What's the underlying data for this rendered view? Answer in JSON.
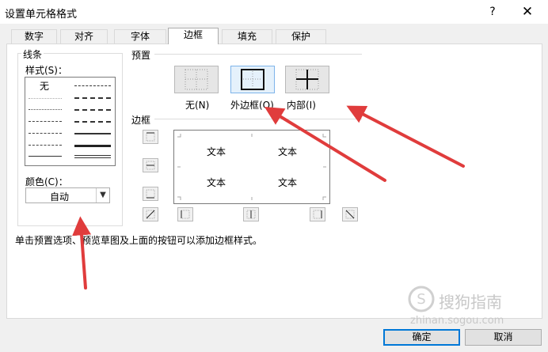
{
  "window": {
    "title": "设置单元格格式",
    "help": "?",
    "close": "✕"
  },
  "tabs": [
    {
      "label": "数字"
    },
    {
      "label": "对齐"
    },
    {
      "label": "字体"
    },
    {
      "label": "边框",
      "active": true
    },
    {
      "label": "填充"
    },
    {
      "label": "保护"
    }
  ],
  "line": {
    "group_label": "线条",
    "style_label": "样式(S)：",
    "none_label": "无",
    "color_label": "颜色(C)：",
    "color_value": "自动"
  },
  "presets": {
    "group_label": "预置",
    "items": [
      {
        "label": "无(N)",
        "icon": "no-border-icon"
      },
      {
        "label": "外边框(O)",
        "icon": "outline-border-icon"
      },
      {
        "label": "内部(I)",
        "icon": "inside-border-icon"
      }
    ]
  },
  "border": {
    "group_label": "边框",
    "preview_text": [
      "文本",
      "文本",
      "文本",
      "文本"
    ]
  },
  "hint": "单击预置选项、预览草图及上面的按钮可以添加边框样式。",
  "buttons": {
    "ok": "确定",
    "cancel": "取消"
  },
  "watermark": {
    "main": "搜狗指南",
    "url": "zhinan.sogou.com"
  },
  "colors": {
    "accent": "#0078d7",
    "annotation_arrow": "#e03c3c"
  }
}
